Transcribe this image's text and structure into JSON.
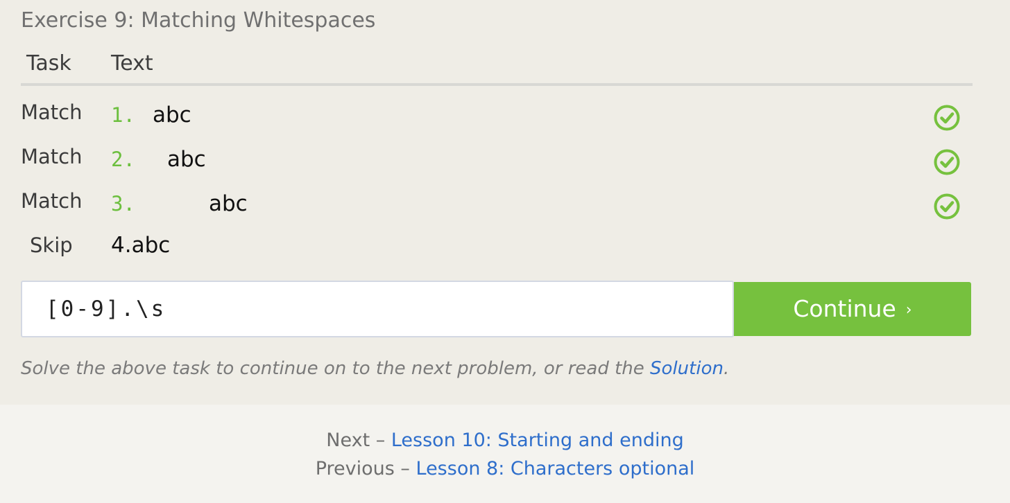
{
  "exercise": {
    "title": "Exercise 9: Matching Whitespaces"
  },
  "table": {
    "headers": {
      "task": "Task",
      "text": "Text"
    },
    "rows": [
      {
        "task": "Match",
        "number": "1.",
        "text": "abc",
        "status": "check-icon"
      },
      {
        "task": "Match",
        "number": "2.",
        "text": "abc",
        "status": "check-icon"
      },
      {
        "task": "Match",
        "number": "3.",
        "text": "abc",
        "status": "check-icon"
      },
      {
        "task": "Skip",
        "text": "4.abc"
      }
    ]
  },
  "input": {
    "value": "[0-9].\\s"
  },
  "continue": {
    "label": "Continue",
    "chevron": "›"
  },
  "hint": {
    "prefix": "Solve the above task to continue on to the next problem, or read the ",
    "link": "Solution",
    "suffix": "."
  },
  "nav": {
    "next_prefix": "Next – ",
    "next_link": "Lesson 10: Starting and ending",
    "prev_prefix": "Previous – ",
    "prev_link": "Lesson 8: Characters optional"
  },
  "colors": {
    "accent": "#76c13e",
    "link": "#2e6ecb",
    "number": "#6cbf3e"
  }
}
